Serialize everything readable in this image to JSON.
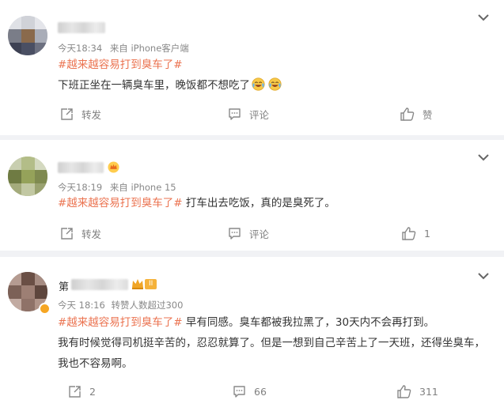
{
  "posts": [
    {
      "time": "今天18:34",
      "source": "来自 iPhone客户端",
      "hashtag": "#越来越容易打到臭车了#",
      "text": "下班正坐在一辆臭车里，晚饭都不想吃了",
      "emoji_icons": [
        "crying-laughing-emoji",
        "crying-laughing-emoji"
      ],
      "actions": {
        "repost": "转发",
        "comment": "评论",
        "like": "赞"
      }
    },
    {
      "time": "今天18:19",
      "source": "来自 iPhone 15",
      "hashtag": "#越来越容易打到臭车了#",
      "text": " 打车出去吃饭，真的是臭死了。",
      "actions": {
        "repost": "转发",
        "comment": "评论",
        "like": "1"
      }
    },
    {
      "name_visible": "第",
      "time": "今天 18:16",
      "source": "转赞人数超过300",
      "badge_text": "II",
      "hashtag": "#越来越容易打到臭车了#",
      "text": " 早有同感。臭车都被我拉黑了，30天内不会再打到。",
      "text2": "我有时候觉得司机挺辛苦的，忍忍就算了。但是一想到自己辛苦上了一天班，还得坐臭车，我也不容易啊。",
      "actions": {
        "repost": "2",
        "comment": "66",
        "like": "311"
      }
    }
  ],
  "colors": {
    "hashtag": "#eb7350",
    "meta": "#888888",
    "background": "#f1f2f5"
  }
}
